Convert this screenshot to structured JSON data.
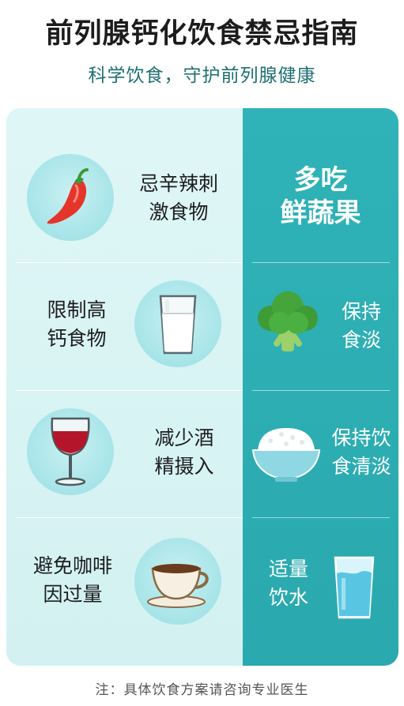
{
  "header": {
    "title": "前列腺钙化饮食禁忌指南",
    "subtitle": "科学饮食，守护前列腺健康"
  },
  "rows": [
    {
      "left_text": "忌辛辣刺\n激食物",
      "left_icon": "chili-pepper-icon",
      "right_text": "多吃\n鲜蔬果",
      "right_icon": ""
    },
    {
      "left_text": "限制高\n钙食物",
      "left_icon": "milk-glass-icon",
      "right_text": "保持\n食淡",
      "right_icon": "broccoli-icon"
    },
    {
      "left_text": "减少酒\n精摄入",
      "left_icon": "wine-glass-icon",
      "right_text": "保持饮\n食清淡",
      "right_icon": "rice-bowl-icon"
    },
    {
      "left_text": "避免咖啡\n因过量",
      "left_icon": "coffee-cup-icon",
      "right_text": "适量\n饮水",
      "right_icon": "water-glass-icon"
    }
  ],
  "footer": {
    "note": "注：具体饮食方案请咨询专业医生"
  },
  "colors": {
    "teal": "#2fb3b8",
    "light_panel": "#dff6f6",
    "icon_circle": "#a6e4e8",
    "subtitle": "#1e6f72"
  }
}
